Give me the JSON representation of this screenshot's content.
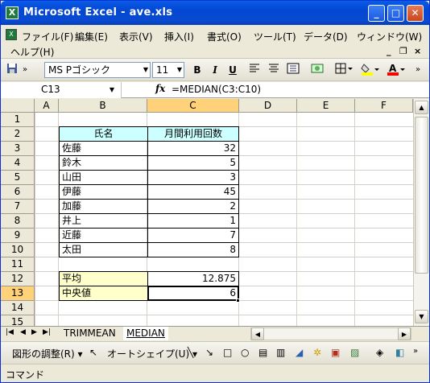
{
  "window": {
    "app_icon": "X",
    "title": "Microsoft Excel - ave.xls",
    "minimize": "_",
    "maximize": "□",
    "close": "✕"
  },
  "menu": {
    "items": [
      "ファイル(F)",
      "編集(E)",
      "表示(V)",
      "挿入(I)",
      "書式(O)",
      "ツール(T)",
      "データ(D)",
      "ウィンドウ(W)",
      "ヘルプ(H)"
    ],
    "doc_min": "_",
    "doc_restore": "❐",
    "doc_close": "×"
  },
  "toolbar": {
    "font_name": "MS Pゴシック",
    "font_size": "11",
    "bold": "B",
    "italic": "I",
    "underline": "U",
    "overflow": "»",
    "save_icon": "save-icon",
    "fill_color": "#ffff00",
    "font_color": "#ff0000"
  },
  "formula_bar": {
    "name_box": "C13",
    "fx": "fx",
    "formula": "=MEDIAN(C3:C10)"
  },
  "grid": {
    "columns": [
      "A",
      "B",
      "C",
      "D",
      "E",
      "F"
    ],
    "rows": [
      "1",
      "2",
      "3",
      "4",
      "5",
      "6",
      "7",
      "8",
      "9",
      "10",
      "11",
      "12",
      "13",
      "14",
      "15"
    ],
    "table_header": {
      "name": "氏名",
      "count": "月間利用回数"
    },
    "table_rows": [
      {
        "name": "佐藤",
        "count": "32"
      },
      {
        "name": "鈴木",
        "count": "5"
      },
      {
        "name": "山田",
        "count": "3"
      },
      {
        "name": "伊藤",
        "count": "45"
      },
      {
        "name": "加藤",
        "count": "2"
      },
      {
        "name": "井上",
        "count": "1"
      },
      {
        "name": "近藤",
        "count": "7"
      },
      {
        "name": "太田",
        "count": "8"
      }
    ],
    "summary": [
      {
        "label": "平均",
        "value": "12.875"
      },
      {
        "label": "中央値",
        "value": "6"
      }
    ],
    "active_cell": "C13"
  },
  "sheets": {
    "tabs": [
      "TRIMMEAN",
      "MEDIAN"
    ],
    "active": "MEDIAN"
  },
  "drawing": {
    "adjust": "図形の調整(R) ▾",
    "autoshape": "オートシェイプ(U) ▾"
  },
  "status": {
    "text": "コマンド"
  }
}
